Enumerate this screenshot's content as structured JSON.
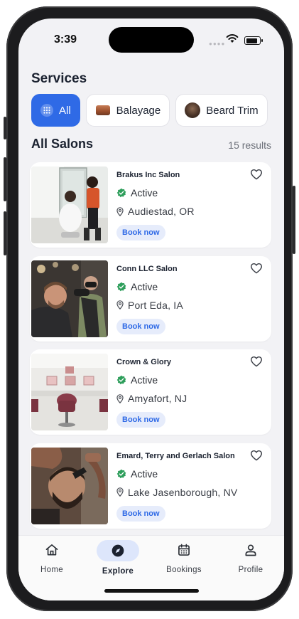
{
  "status_bar": {
    "time": "3:39"
  },
  "services": {
    "heading": "Services",
    "chips": [
      {
        "label": "All",
        "icon": "grid-icon",
        "selected": true
      },
      {
        "label": "Balayage",
        "icon": "balayage-thumbnail"
      },
      {
        "label": "Beard Trim",
        "icon": "beard-trim-thumbnail"
      }
    ]
  },
  "salons": {
    "heading": "All Salons",
    "results": "15 results",
    "items": [
      {
        "name": "Brakus Inc Salon",
        "status": "Active",
        "location": "Audiestad, OR",
        "cta": "Book now"
      },
      {
        "name": "Conn LLC Salon",
        "status": "Active",
        "location": "Port Eda, IA",
        "cta": "Book now"
      },
      {
        "name": "Crown & Glory",
        "status": "Active",
        "location": "Amyafort, NJ",
        "cta": "Book now"
      },
      {
        "name": "Emard, Terry and Gerlach Salon",
        "status": "Active",
        "location": "Lake Jasenborough, NV",
        "cta": "Book now"
      }
    ]
  },
  "tabbar": {
    "tabs": [
      {
        "label": "Home",
        "icon": "home-icon"
      },
      {
        "label": "Explore",
        "icon": "compass-icon",
        "active": true
      },
      {
        "label": "Bookings",
        "icon": "calendar-icon"
      },
      {
        "label": "Profile",
        "icon": "user-icon"
      }
    ]
  },
  "colors": {
    "accent": "#2f6ae6",
    "active_status": "#2e9e5b",
    "tab_active_bg": "#dde6fb"
  }
}
